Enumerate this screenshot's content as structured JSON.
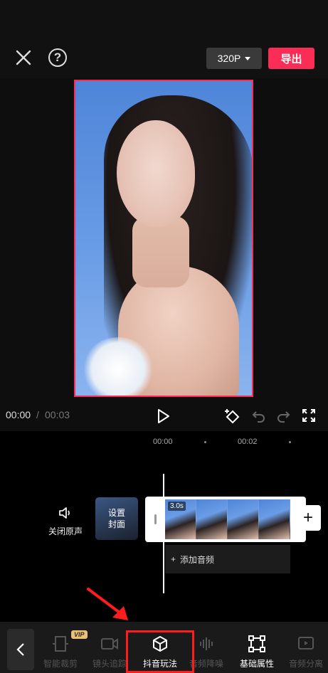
{
  "header": {
    "resolution_label": "320P",
    "export_label": "导出"
  },
  "colors": {
    "accent": "#fb2c55",
    "annotation": "#ff1c1c",
    "background": "#0e0e0e"
  },
  "playback": {
    "current_time": "00:00",
    "separator": "/",
    "total_time": "00:03"
  },
  "ruler": {
    "labels": [
      "00:00",
      "00:02"
    ]
  },
  "track": {
    "mute_label": "关闭原声",
    "cover_label_line1": "设置",
    "cover_label_line2": "封面",
    "clip_duration": "3.0s",
    "add_audio_label": "添加音频",
    "add_icon": "+"
  },
  "toolbar": {
    "vip_badge": "VIP",
    "items": [
      {
        "label": "智能裁剪",
        "icon": "crop-icon"
      },
      {
        "label": "镜头追踪",
        "icon": "camera-track-icon"
      },
      {
        "label": "抖音玩法",
        "icon": "cube-icon"
      },
      {
        "label": "音频降噪",
        "icon": "noise-reduction-icon"
      },
      {
        "label": "基础属性",
        "icon": "transform-icon"
      },
      {
        "label": "音频分离",
        "icon": "audio-split-icon"
      }
    ]
  }
}
